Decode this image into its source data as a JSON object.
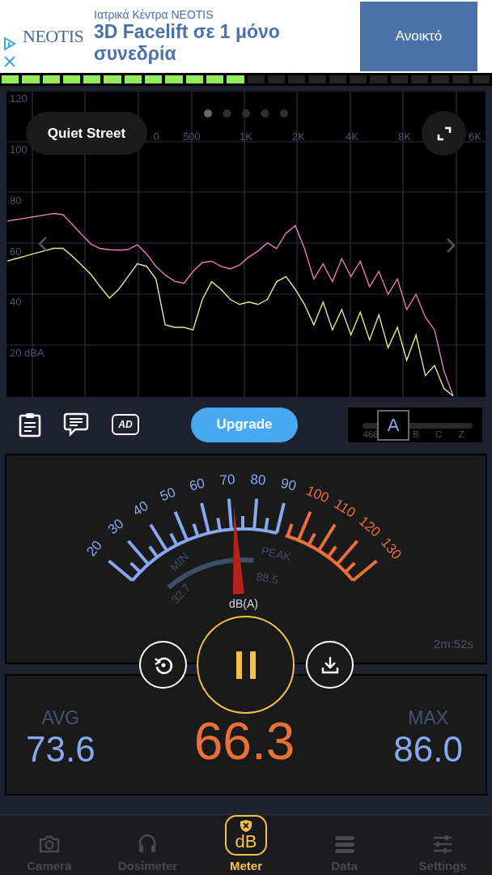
{
  "ad": {
    "logo": "NEOTIS",
    "sponsor": "Ιατρικά Κέντρα NEOTIS",
    "headline": "3D Facelift σε 1 μόνο συνεδρία",
    "button": "Ανοικτό"
  },
  "level_meter": {
    "level": 0.5
  },
  "spectrum": {
    "preset": "Quiet Street",
    "pages": [
      {
        "selected": true
      },
      {
        "selected": false
      },
      {
        "selected": false
      },
      {
        "selected": false
      },
      {
        "selected": false
      }
    ],
    "x_labels": [
      "0",
      "500",
      "1K",
      "2K",
      "4K",
      "8K",
      "6K"
    ],
    "chart_data": {
      "type": "line",
      "grid": true,
      "ylim": [
        0,
        120
      ],
      "yticks": [
        {
          "value": 120,
          "label": "120"
        },
        {
          "value": 100,
          "label": "100"
        },
        {
          "value": 80,
          "label": "80"
        },
        {
          "value": 60,
          "label": "60"
        },
        {
          "value": 40,
          "label": "40"
        },
        {
          "value": 20,
          "label": "20 dBA"
        }
      ],
      "series": [
        {
          "color": "#e87bb8",
          "values": [
            68.8,
            69.4,
            70,
            70.6,
            71.2,
            71.8,
            71.3,
            67.5,
            63.6,
            59.8,
            58,
            57.5,
            57.4,
            57.6,
            59.5,
            55.9,
            51,
            47.6,
            45.1,
            44.3,
            49,
            52.5,
            53,
            51,
            50,
            51.5,
            54.7,
            57,
            60.2,
            58,
            64,
            67,
            58,
            46,
            52,
            45,
            54,
            47,
            53,
            43,
            49,
            40,
            46,
            34,
            40,
            31,
            26,
            10,
            0
          ]
        },
        {
          "color": "#d6f58a",
          "values": [
            53.1,
            54.1,
            55.1,
            56.1,
            57.1,
            58.1,
            58.1,
            55,
            51.5,
            47.9,
            43,
            38.5,
            42,
            47,
            52,
            51,
            46,
            28,
            27,
            27,
            26,
            38,
            45,
            42,
            38,
            36,
            37,
            36,
            38,
            45,
            47,
            42,
            36,
            28,
            37,
            26,
            34,
            24,
            33,
            22,
            32,
            19,
            27,
            14,
            24,
            8,
            12,
            3,
            0
          ]
        }
      ]
    }
  },
  "toolbar": {
    "ad_icon_text": "AD",
    "upgrade": "Upgrade",
    "weighting": [
      {
        "label": "468",
        "selected": false
      },
      {
        "label": "A",
        "selected": true
      },
      {
        "label": "B",
        "selected": false
      },
      {
        "label": "C",
        "selected": false
      },
      {
        "label": "Z",
        "selected": false
      }
    ]
  },
  "gauge": {
    "scale": [
      {
        "label": "20",
        "kind": "safe"
      },
      {
        "label": "30",
        "kind": "safe"
      },
      {
        "label": "40",
        "kind": "safe"
      },
      {
        "label": "50",
        "kind": "safe"
      },
      {
        "label": "60",
        "kind": "safe"
      },
      {
        "label": "70",
        "kind": "safe"
      },
      {
        "label": "80",
        "kind": "safe"
      },
      {
        "label": "90",
        "kind": "safe"
      },
      {
        "label": "100",
        "kind": "loud"
      },
      {
        "label": "110",
        "kind": "loud"
      },
      {
        "label": "120",
        "kind": "loud"
      },
      {
        "label": "130",
        "kind": "loud"
      }
    ],
    "min_label": "MIN",
    "min": "32.7",
    "peak_label": "PEAK",
    "peak": "88.5",
    "unit": "dB(A)",
    "level": 0.47,
    "elapsed": "2m:52s"
  },
  "stats": {
    "avg_label": "AVG",
    "avg": "73.6",
    "current": "66.3",
    "max_label": "MAX",
    "max": "86.0"
  },
  "tabs": [
    {
      "label": "Camera",
      "selected": false
    },
    {
      "label": "Dosimeter",
      "selected": false
    },
    {
      "label": "Meter",
      "selected": true,
      "icon_text": "dB"
    },
    {
      "label": "Data",
      "selected": false
    },
    {
      "label": "Settings",
      "selected": false
    }
  ]
}
